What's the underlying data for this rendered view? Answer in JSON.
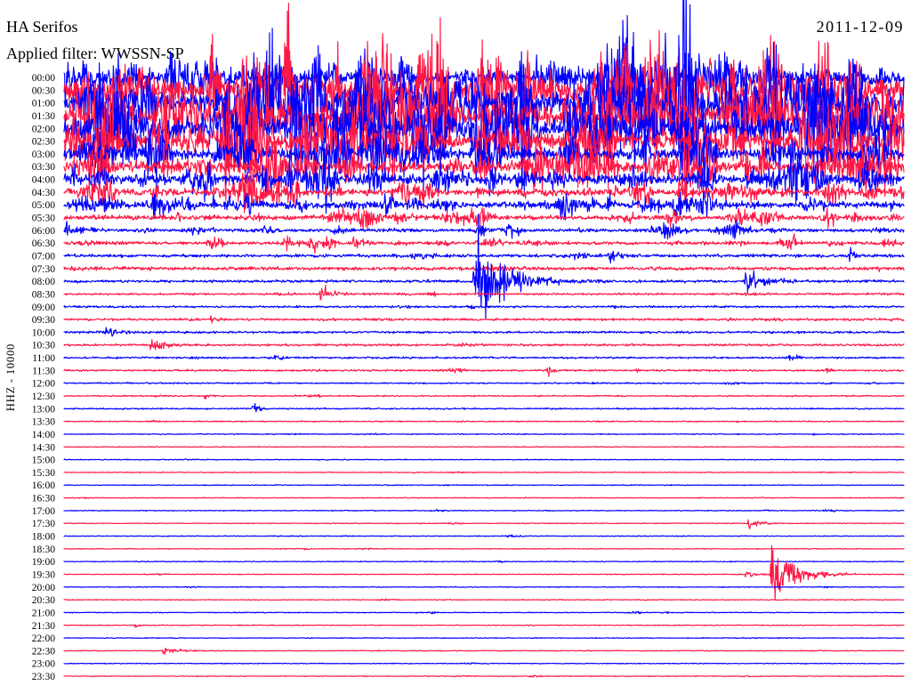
{
  "chart_data": {
    "type": "line",
    "title": "HA Serifos",
    "date": "2011-12-09",
    "filter_label": "Applied filter: WWSSN-SP",
    "ylabel": "HHZ - 10000",
    "y_ticks": [
      "00:00",
      "00:30",
      "01:00",
      "01:30",
      "02:00",
      "02:30",
      "03:00",
      "03:30",
      "04:00",
      "04:30",
      "05:00",
      "05:30",
      "06:00",
      "06:30",
      "07:00",
      "07:30",
      "08:00",
      "08:30",
      "09:00",
      "09:30",
      "10:00",
      "10:30",
      "11:00",
      "11:30",
      "12:00",
      "12:30",
      "13:00",
      "13:30",
      "14:00",
      "14:30",
      "15:00",
      "15:30",
      "16:00",
      "16:30",
      "17:00",
      "17:30",
      "18:00",
      "18:30",
      "19:00",
      "19:30",
      "20:00",
      "20:30",
      "21:00",
      "21:30",
      "22:00",
      "22:30",
      "23:00",
      "23:30"
    ],
    "trace_colors": [
      "#0000ff",
      "#ff1744"
    ],
    "noise_level": [
      0.55,
      0.9,
      0.9,
      0.85,
      0.8,
      0.65,
      0.5,
      0.5,
      0.42,
      0.3,
      0.28,
      0.2,
      0.14,
      0.14,
      0.08,
      0.09,
      0.065,
      0.05,
      0.05,
      0.06,
      0.055,
      0.055,
      0.045,
      0.045,
      0.035,
      0.035,
      0.035,
      0.03,
      0.025,
      0.022,
      0.022,
      0.022,
      0.022,
      0.022,
      0.022,
      0.022,
      0.022,
      0.022,
      0.022,
      0.022,
      0.022,
      0.022,
      0.022,
      0.022,
      0.022,
      0.022,
      0.022,
      0.022
    ],
    "events": [
      {
        "row": "04:00",
        "start_min": 13.3,
        "duration_min": 1.2,
        "amplitude": 0.7
      },
      {
        "row": "04:00",
        "start_min": 17.4,
        "duration_min": 1.0,
        "amplitude": 0.6
      },
      {
        "row": "04:00",
        "start_min": 26.5,
        "duration_min": 0.8,
        "amplitude": 0.9
      },
      {
        "row": "04:30",
        "start_min": 21.9,
        "duration_min": 0.8,
        "amplitude": 0.5
      },
      {
        "row": "04:30",
        "start_min": 27.4,
        "duration_min": 1.0,
        "amplitude": 0.55
      },
      {
        "row": "05:00",
        "start_min": 3.1,
        "duration_min": 1.8,
        "amplitude": 0.5
      },
      {
        "row": "05:00",
        "start_min": 5.8,
        "duration_min": 0.8,
        "amplitude": 0.45
      },
      {
        "row": "05:30",
        "start_min": 11.8,
        "duration_min": 1.0,
        "amplitude": 0.35
      },
      {
        "row": "06:00",
        "start_min": 0.0,
        "duration_min": 1.8,
        "amplitude": 0.3
      },
      {
        "row": "06:30",
        "start_min": 10.3,
        "duration_min": 1.1,
        "amplitude": 0.3
      },
      {
        "row": "07:00",
        "start_min": 19.4,
        "duration_min": 1.0,
        "amplitude": 0.3
      },
      {
        "row": "07:00",
        "start_min": 28.0,
        "duration_min": 0.5,
        "amplitude": 0.5
      },
      {
        "row": "08:00",
        "start_min": 14.6,
        "duration_min": 2.8,
        "amplitude": 1.6
      },
      {
        "row": "08:00",
        "start_min": 24.3,
        "duration_min": 1.5,
        "amplitude": 0.45
      },
      {
        "row": "08:30",
        "start_min": 9.1,
        "duration_min": 1.4,
        "amplitude": 0.25
      },
      {
        "row": "09:30",
        "start_min": 5.2,
        "duration_min": 0.5,
        "amplitude": 0.25
      },
      {
        "row": "10:00",
        "start_min": 1.45,
        "duration_min": 1.3,
        "amplitude": 0.2
      },
      {
        "row": "10:30",
        "start_min": 3.05,
        "duration_min": 1.3,
        "amplitude": 0.3
      },
      {
        "row": "11:00",
        "start_min": 4.4,
        "duration_min": 0.5,
        "amplitude": 0.15
      },
      {
        "row": "11:30",
        "start_min": 17.25,
        "duration_min": 0.5,
        "amplitude": 0.2
      },
      {
        "row": "12:30",
        "start_min": 5.0,
        "duration_min": 0.4,
        "amplitude": 0.12
      },
      {
        "row": "13:00",
        "start_min": 6.7,
        "duration_min": 0.5,
        "amplitude": 0.3
      },
      {
        "row": "17:30",
        "start_min": 24.4,
        "duration_min": 1.0,
        "amplitude": 0.2
      },
      {
        "row": "19:30",
        "start_min": 24.3,
        "duration_min": 1.0,
        "amplitude": 0.15
      },
      {
        "row": "19:30",
        "start_min": 25.2,
        "duration_min": 2.0,
        "amplitude": 1.0
      },
      {
        "row": "21:00",
        "start_min": 13.1,
        "duration_min": 0.3,
        "amplitude": 0.1
      },
      {
        "row": "21:30",
        "start_min": 2.5,
        "duration_min": 0.5,
        "amplitude": 0.12
      },
      {
        "row": "22:30",
        "start_min": 3.5,
        "duration_min": 1.4,
        "amplitude": 0.15
      }
    ]
  }
}
